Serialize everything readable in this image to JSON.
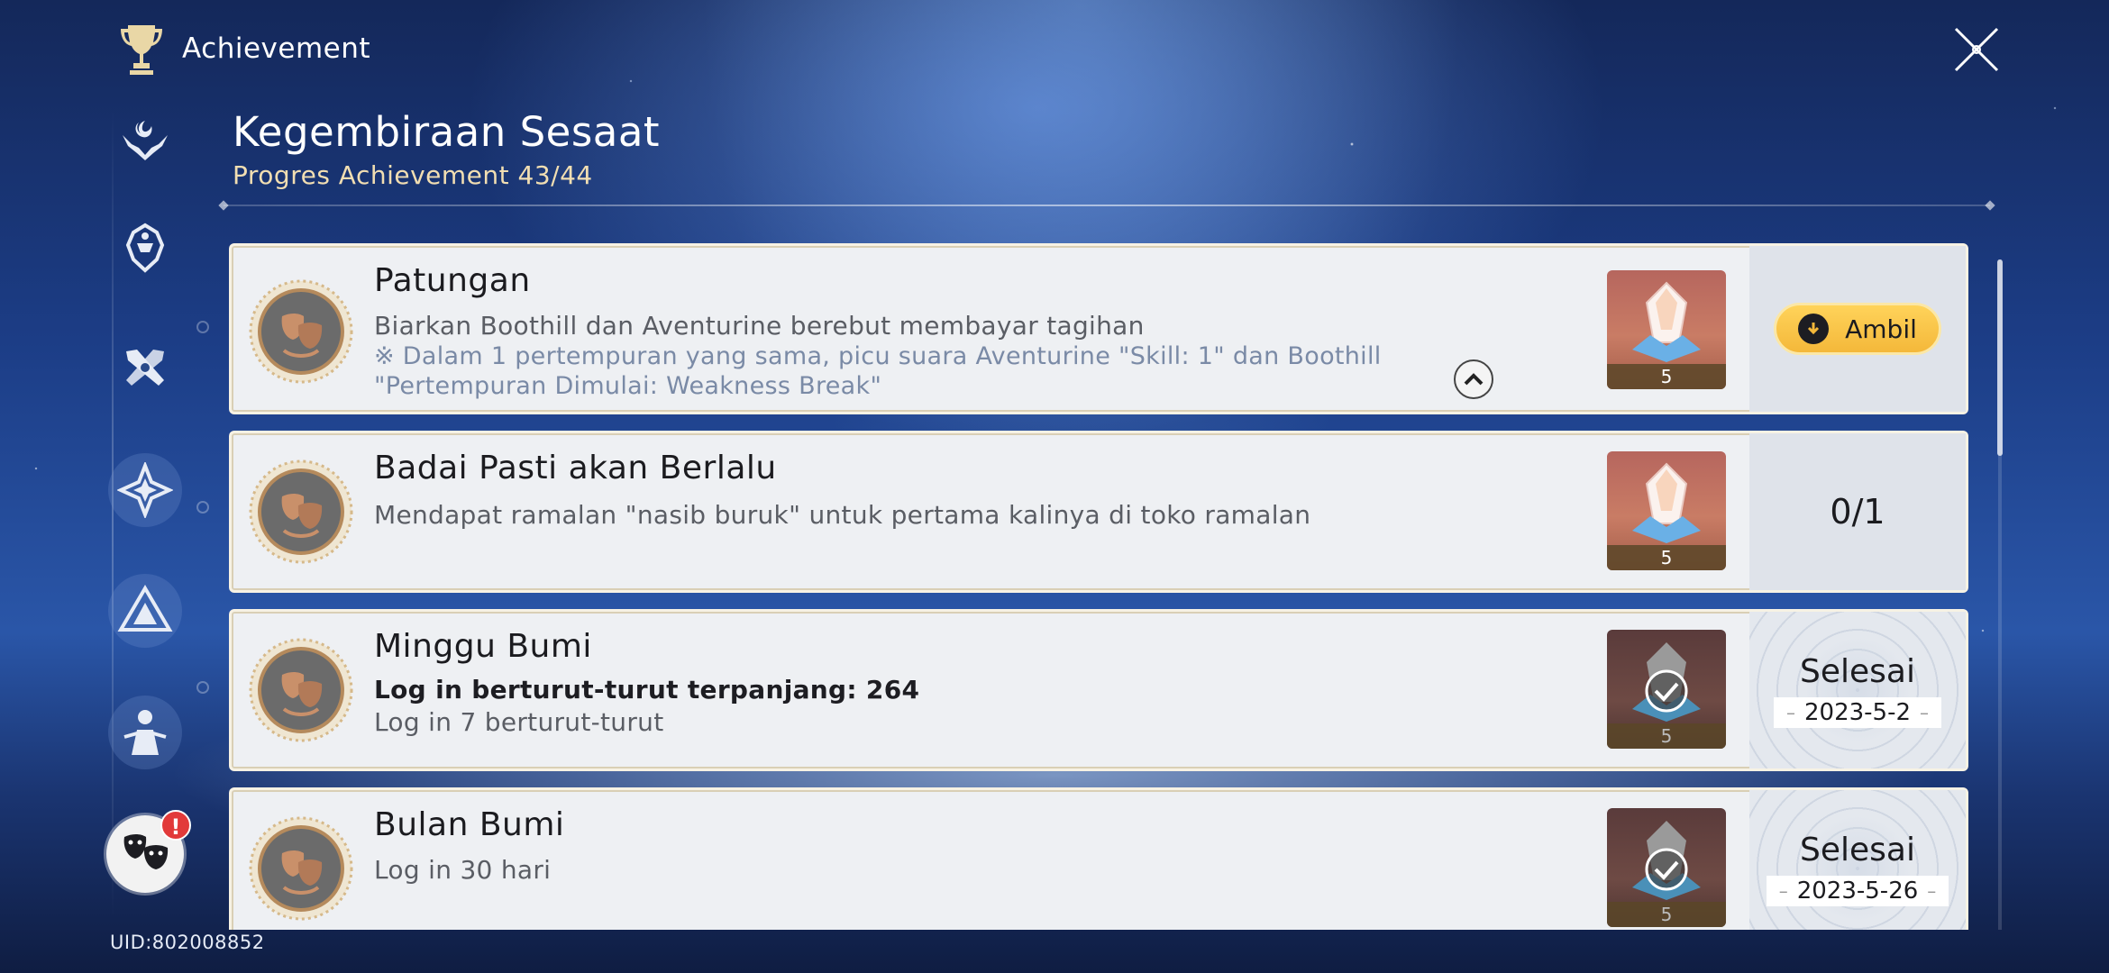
{
  "header": {
    "title": "Achievement"
  },
  "page": {
    "title": "Kegembiraan Sesaat",
    "progress": "Progres Achievement 43/44"
  },
  "uid": "UID:802008852",
  "sidebar": {
    "items": [
      {
        "icon": "hands-crescent-icon"
      },
      {
        "icon": "helmet-crest-icon"
      },
      {
        "icon": "crossed-tools-icon"
      },
      {
        "icon": "star-diamond-icon"
      },
      {
        "icon": "triangle-emblem-icon"
      },
      {
        "icon": "robed-figure-icon"
      },
      {
        "icon": "theater-masks-icon",
        "active": true,
        "badge": "!"
      }
    ]
  },
  "achievements": [
    {
      "name": "Patungan",
      "desc": "Biarkan Boothill dan Aventurine berebut membayar tagihan",
      "note": "※ Dalam 1 pertempuran yang sama, picu suara Aventurine \"Skill: 1\" dan Boothill \"Pertempuran Dimulai: Weakness Break\"",
      "reward_count": "5",
      "status": {
        "button_label": "Ambil"
      }
    },
    {
      "name": "Badai Pasti akan Berlalu",
      "desc": "Mendapat ramalan \"nasib buruk\" untuk pertama kalinya di toko ramalan",
      "reward_count": "5",
      "status": {
        "ratio": "0/1"
      }
    },
    {
      "name": "Minggu Bumi",
      "subtitle": "Log in berturut-turut terpanjang: 264",
      "desc": "Log in 7 berturut-turut",
      "reward_count": "5",
      "status": {
        "done_label": "Selesai",
        "date": "2023-5-2"
      }
    },
    {
      "name": "Bulan Bumi",
      "desc": "Log in 30 hari",
      "reward_count": "5",
      "status": {
        "done_label": "Selesai",
        "date": "2023-5-26"
      }
    }
  ],
  "colors": {
    "accent_gold": "#f4b83a",
    "progress_text": "#f1deb2",
    "badge_red": "#e23a3a"
  }
}
